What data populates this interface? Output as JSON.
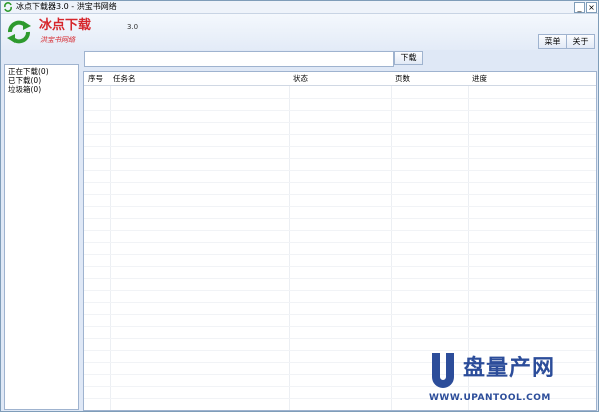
{
  "window": {
    "title": "冰点下载器3.0 - 洪宝书网络",
    "minimize_label": "_",
    "close_label": "×"
  },
  "header": {
    "logo_title": "冰点下载",
    "logo_subtitle": "洪宝书网络",
    "version": "3.0",
    "menu_label": "菜单",
    "about_label": "关于"
  },
  "toolbar": {
    "url_value": "",
    "download_label": "下载"
  },
  "sidebar": {
    "items": [
      {
        "label": "正在下载(0)"
      },
      {
        "label": "已下载(0)"
      },
      {
        "label": "垃圾箱(0)"
      }
    ]
  },
  "table": {
    "columns": [
      {
        "label": "序号"
      },
      {
        "label": "任务名"
      },
      {
        "label": "状态"
      },
      {
        "label": "页数"
      },
      {
        "label": "进度"
      }
    ],
    "rows": []
  },
  "watermark": {
    "brand": "盘量产网",
    "url": "WWW.UPANTOOL.COM"
  },
  "colors": {
    "logo_red": "#d6262c",
    "logo_green": "#2e9a2e",
    "watermark_blue": "#2c4d9a"
  }
}
